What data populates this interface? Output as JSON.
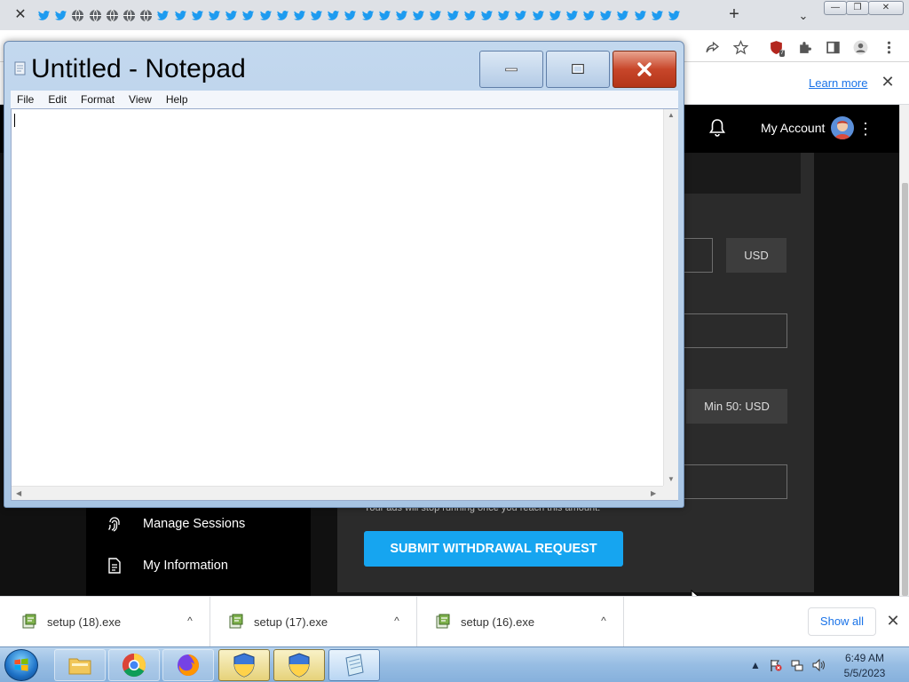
{
  "browser": {
    "tab_close_glyph": "✕",
    "new_tab_glyph": "+",
    "tab_search_glyph": "⌄",
    "tab_favicons": [
      "twitter",
      "twitter",
      "globe",
      "globe",
      "globe",
      "globe",
      "globe",
      "twitter",
      "twitter",
      "twitter",
      "twitter",
      "twitter",
      "twitter",
      "twitter",
      "twitter",
      "twitter",
      "twitter",
      "twitter",
      "twitter",
      "twitter",
      "twitter",
      "twitter",
      "twitter",
      "twitter",
      "twitter",
      "twitter",
      "twitter",
      "twitter",
      "twitter",
      "twitter",
      "twitter",
      "twitter",
      "twitter",
      "twitter",
      "twitter",
      "twitter",
      "twitter",
      "twitter"
    ],
    "ext_badge": "7",
    "infobar": {
      "learn_more": "Learn more",
      "close_glyph": "✕"
    }
  },
  "page": {
    "account_label": "My Account",
    "currency": "USD",
    "min_label": "Min 50: USD",
    "note": "Your ads will stop running once you reach this amount.",
    "submit_label": "SUBMIT WITHDRAWAL REQUEST",
    "sidebar": [
      {
        "label": "Manage Sessions",
        "icon": "fingerprint-icon"
      },
      {
        "label": "My Information",
        "icon": "document-icon"
      }
    ]
  },
  "notepad": {
    "title": "Untitled - Notepad",
    "menu": [
      "File",
      "Edit",
      "Format",
      "View",
      "Help"
    ],
    "content": ""
  },
  "downloads": {
    "items": [
      {
        "name": "setup (18).exe"
      },
      {
        "name": "setup (17).exe"
      },
      {
        "name": "setup (16).exe"
      }
    ],
    "show_all": "Show all",
    "chevron_glyph": "^",
    "close_glyph": "✕"
  },
  "taskbar": {
    "time": "6:49 AM",
    "date": "5/5/2023"
  },
  "colors": {
    "twitter_blue": "#1d9bf0",
    "submit_blue": "#16a5f0",
    "close_red": "#c8462a"
  }
}
